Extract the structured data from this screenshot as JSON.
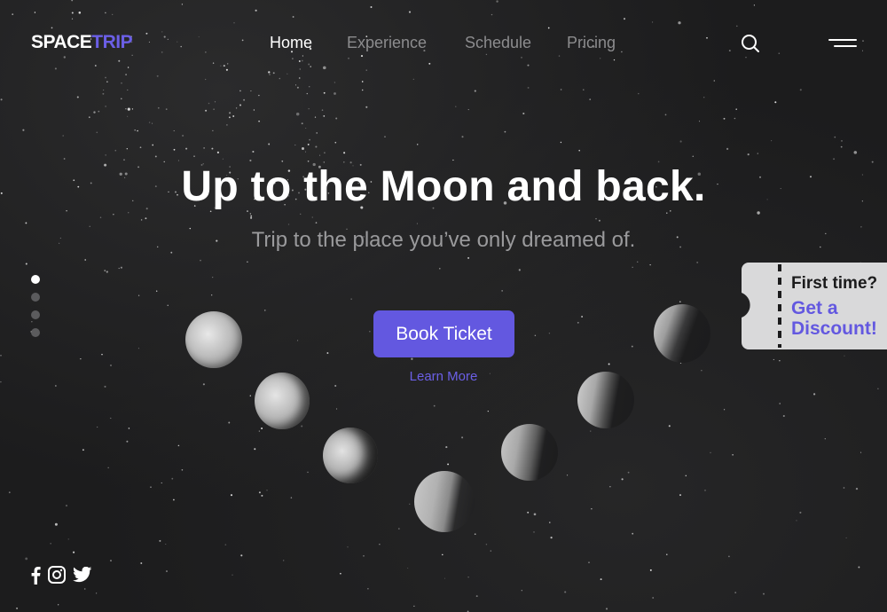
{
  "brand": {
    "name_part1": "SPACE",
    "name_part2": "TRIP",
    "accent_color": "#6358e0"
  },
  "nav": {
    "items": [
      {
        "label": "Home",
        "active": true
      },
      {
        "label": "Experience",
        "active": false
      },
      {
        "label": "Schedule",
        "active": false
      },
      {
        "label": "Pricing",
        "active": false
      }
    ],
    "search_icon": "search-icon",
    "menu_icon": "hamburger-menu-icon"
  },
  "hero": {
    "title": "Up to the Moon and back.",
    "subtitle": "Trip to the place you’ve only dreamed of.",
    "cta_label": "Book Ticket",
    "secondary_link": "Learn More"
  },
  "slider": {
    "total": 4,
    "active_index": 0
  },
  "ticket": {
    "line1": "First time?",
    "line2": "Get a Discount!"
  },
  "social": {
    "icons": [
      "facebook-icon",
      "instagram-icon",
      "twitter-icon"
    ]
  }
}
